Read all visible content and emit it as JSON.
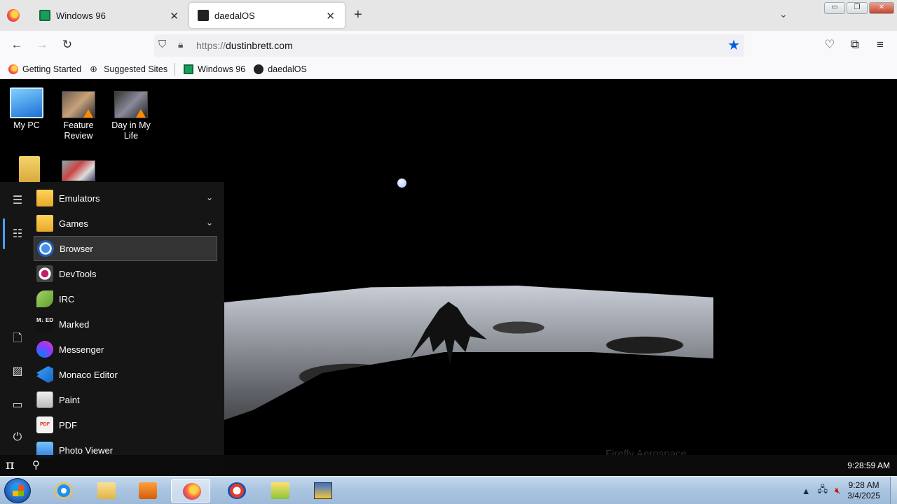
{
  "browser": {
    "tabs": [
      {
        "title": "Windows 96"
      },
      {
        "title": "daedalOS"
      }
    ],
    "url_protocol": "https://",
    "url_host": "dustinbrett.com",
    "bookmarks": [
      "Getting Started",
      "Suggested Sites",
      "Windows 96",
      "daedalOS"
    ],
    "window_buttons": {
      "minimize": "▭",
      "restore": "❐",
      "close": "✕"
    },
    "accent": "#0061e0"
  },
  "desktop": {
    "icons": [
      {
        "label": "My PC",
        "icon": "computer-icon"
      },
      {
        "label": "Feature Review",
        "icon": "video-thumbnail-icon"
      },
      {
        "label": "Day in My Life",
        "icon": "video-thumbnail-icon"
      }
    ],
    "watermark": "Firefly Aerospace"
  },
  "start_menu": {
    "items": [
      {
        "label": "Emulators",
        "icon": "folder-icon",
        "expandable": true
      },
      {
        "label": "Games",
        "icon": "folder-icon",
        "expandable": true
      },
      {
        "label": "Browser",
        "icon": "browser-icon"
      },
      {
        "label": "DevTools",
        "icon": "devtools-icon"
      },
      {
        "label": "IRC",
        "icon": "irc-icon"
      },
      {
        "label": "Marked",
        "icon": "marked-icon"
      },
      {
        "label": "Messenger",
        "icon": "messenger-icon"
      },
      {
        "label": "Monaco Editor",
        "icon": "monaco-icon"
      },
      {
        "label": "Paint",
        "icon": "paint-icon"
      },
      {
        "label": "PDF",
        "icon": "pdf-icon"
      },
      {
        "label": "Photo Viewer",
        "icon": "photo-viewer-icon"
      }
    ],
    "marked_glyph": "M↓ ED",
    "pdf_glyph": "PDF"
  },
  "os_taskbar": {
    "start_glyph": "π",
    "clock": "9:28:59 AM"
  },
  "windows_taskbar": {
    "time": "9:28 AM",
    "date": "3/4/2025"
  }
}
